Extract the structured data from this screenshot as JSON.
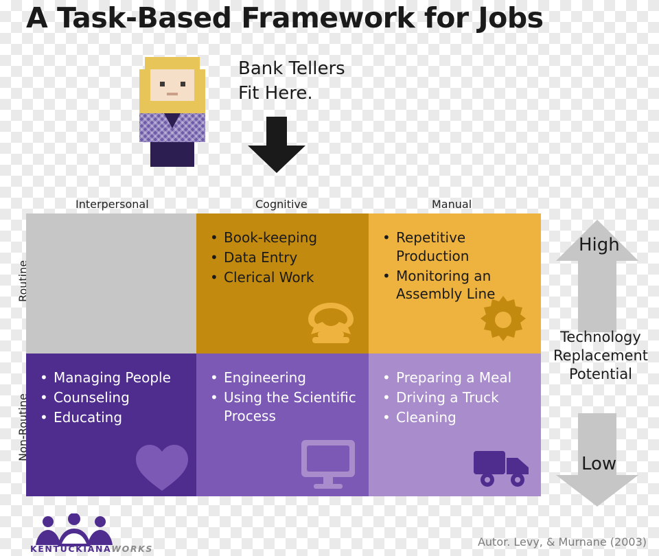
{
  "title": "A Task-Based Framework for Jobs",
  "annotation": {
    "line1": "Bank Tellers",
    "line2": "Fit Here."
  },
  "icons": {
    "person": "pixel-person-icon",
    "down_arrow": "down-arrow-icon",
    "telephone": "telephone-icon",
    "gear": "gear-icon",
    "heart": "heart-icon",
    "monitor": "monitor-icon",
    "truck": "truck-icon",
    "up_arrow": "up-arrow-icon",
    "down_gauge_arrow": "down-arrow-icon",
    "logo": "kentuckiana-works-logo-icon"
  },
  "matrix": {
    "columns": [
      "Interpersonal",
      "Cognitive",
      "Manual"
    ],
    "rows": [
      "Routine",
      "Non-Routine"
    ],
    "cells": [
      {
        "id": "interpersonal-routine",
        "column": "Interpersonal",
        "row": "Routine",
        "color": "#c6c6c6",
        "items": []
      },
      {
        "id": "cognitive-routine",
        "column": "Cognitive",
        "row": "Routine",
        "color": "#c38a10",
        "items": [
          "Book-keeping",
          "Data Entry",
          "Clerical Work"
        ]
      },
      {
        "id": "manual-routine",
        "column": "Manual",
        "row": "Routine",
        "color": "#edb33e",
        "items": [
          "Repetitive Production",
          "Monitoring an Assembly Line"
        ]
      },
      {
        "id": "interpersonal-nonroutine",
        "column": "Interpersonal",
        "row": "Non-Routine",
        "color": "#4f2d8f",
        "items": [
          "Managing People",
          "Counseling",
          "Educating"
        ]
      },
      {
        "id": "cognitive-nonroutine",
        "column": "Cognitive",
        "row": "Non-Routine",
        "color": "#7b59b5",
        "items": [
          "Engineering",
          "Using the Scientific Process"
        ]
      },
      {
        "id": "manual-nonroutine",
        "column": "Manual",
        "row": "Non-Routine",
        "color": "#a88ccb",
        "items": [
          "Preparing a Meal",
          "Driving a Truck",
          "Cleaning"
        ]
      }
    ]
  },
  "gauge": {
    "high_label": "High",
    "low_label": "Low",
    "caption": "Technology Replacement Potential",
    "arrow_color": "#c6c6c6"
  },
  "footer": {
    "logo_name_main": "KENTUCKIANA",
    "logo_name_accent": "WORKS",
    "credit": "Autor. Levy, & Murnane (2003)"
  }
}
